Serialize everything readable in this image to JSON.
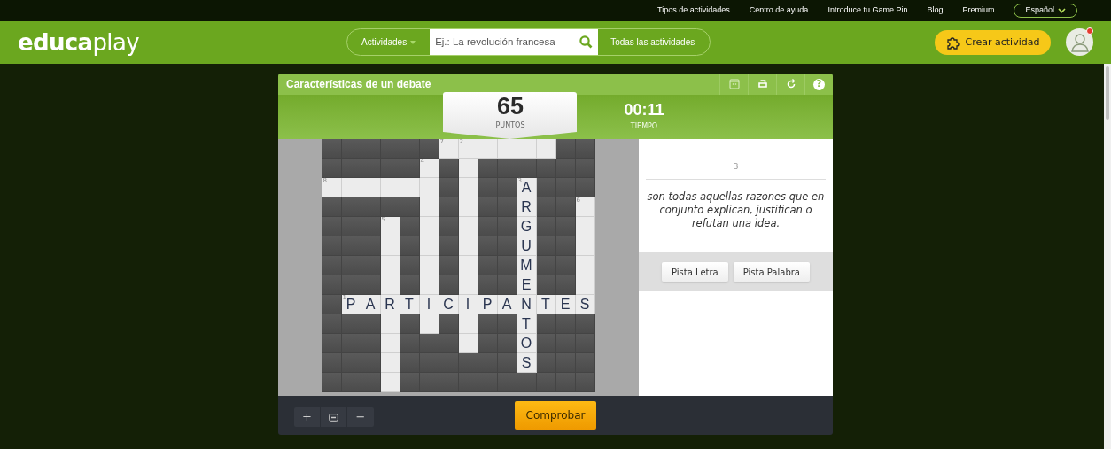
{
  "top_links": [
    "Tipos de actividades",
    "Centro de ayuda",
    "Introduce tu Game Pin",
    "Blog",
    "Premium"
  ],
  "language": {
    "label": "Español"
  },
  "logo": {
    "part1": "educa",
    "part2": "play"
  },
  "search": {
    "category": "Actividades",
    "placeholder": "Ej.: La revolución francesa",
    "all_label": "Todas las actividades"
  },
  "create_button": "Crear actividad",
  "user": {
    "notification": true
  },
  "activity": {
    "title": "Características de un debate",
    "score": {
      "value": "65",
      "label": "PUNTOS"
    },
    "timer": {
      "value": "00:11",
      "label": "TIEMPO"
    },
    "help_label": "?",
    "grid": [
      [
        {
          "kind": "block"
        },
        {
          "kind": "block"
        },
        {
          "kind": "block"
        },
        {
          "kind": "block"
        },
        {
          "kind": "block"
        },
        {
          "kind": "block"
        },
        {
          "kind": "open",
          "number": "7"
        },
        {
          "kind": "open",
          "number": "2"
        },
        {
          "kind": "open"
        },
        {
          "kind": "open"
        },
        {
          "kind": "open"
        },
        {
          "kind": "open"
        },
        {
          "kind": "block"
        },
        {
          "kind": "block"
        }
      ],
      [
        {
          "kind": "block"
        },
        {
          "kind": "block"
        },
        {
          "kind": "block"
        },
        {
          "kind": "block"
        },
        {
          "kind": "block"
        },
        {
          "kind": "open",
          "number": "4"
        },
        {
          "kind": "block"
        },
        {
          "kind": "open"
        },
        {
          "kind": "block"
        },
        {
          "kind": "block"
        },
        {
          "kind": "block"
        },
        {
          "kind": "block"
        },
        {
          "kind": "block"
        },
        {
          "kind": "block"
        }
      ],
      [
        {
          "kind": "open",
          "number": "8"
        },
        {
          "kind": "open"
        },
        {
          "kind": "open"
        },
        {
          "kind": "open"
        },
        {
          "kind": "open"
        },
        {
          "kind": "open"
        },
        {
          "kind": "block"
        },
        {
          "kind": "open"
        },
        {
          "kind": "block"
        },
        {
          "kind": "block"
        },
        {
          "kind": "open",
          "number": "3",
          "letter": "A"
        },
        {
          "kind": "block"
        },
        {
          "kind": "block"
        },
        {
          "kind": "block"
        }
      ],
      [
        {
          "kind": "block"
        },
        {
          "kind": "block"
        },
        {
          "kind": "block"
        },
        {
          "kind": "block"
        },
        {
          "kind": "block"
        },
        {
          "kind": "open"
        },
        {
          "kind": "block"
        },
        {
          "kind": "open"
        },
        {
          "kind": "block"
        },
        {
          "kind": "block"
        },
        {
          "kind": "open",
          "letter": "R"
        },
        {
          "kind": "block"
        },
        {
          "kind": "block"
        },
        {
          "kind": "open",
          "number": "6"
        }
      ],
      [
        {
          "kind": "block"
        },
        {
          "kind": "block"
        },
        {
          "kind": "block"
        },
        {
          "kind": "open",
          "number": "5"
        },
        {
          "kind": "block"
        },
        {
          "kind": "open"
        },
        {
          "kind": "block"
        },
        {
          "kind": "open"
        },
        {
          "kind": "block"
        },
        {
          "kind": "block"
        },
        {
          "kind": "open",
          "letter": "G"
        },
        {
          "kind": "block"
        },
        {
          "kind": "block"
        },
        {
          "kind": "open"
        }
      ],
      [
        {
          "kind": "block"
        },
        {
          "kind": "block"
        },
        {
          "kind": "block"
        },
        {
          "kind": "open"
        },
        {
          "kind": "block"
        },
        {
          "kind": "open"
        },
        {
          "kind": "block"
        },
        {
          "kind": "open"
        },
        {
          "kind": "block"
        },
        {
          "kind": "block"
        },
        {
          "kind": "open",
          "letter": "U"
        },
        {
          "kind": "block"
        },
        {
          "kind": "block"
        },
        {
          "kind": "open"
        }
      ],
      [
        {
          "kind": "block"
        },
        {
          "kind": "block"
        },
        {
          "kind": "block"
        },
        {
          "kind": "open"
        },
        {
          "kind": "block"
        },
        {
          "kind": "open"
        },
        {
          "kind": "block"
        },
        {
          "kind": "open"
        },
        {
          "kind": "block"
        },
        {
          "kind": "block"
        },
        {
          "kind": "open",
          "letter": "M"
        },
        {
          "kind": "block"
        },
        {
          "kind": "block"
        },
        {
          "kind": "open"
        }
      ],
      [
        {
          "kind": "block"
        },
        {
          "kind": "block"
        },
        {
          "kind": "block"
        },
        {
          "kind": "open"
        },
        {
          "kind": "block"
        },
        {
          "kind": "open"
        },
        {
          "kind": "block"
        },
        {
          "kind": "open"
        },
        {
          "kind": "block"
        },
        {
          "kind": "block"
        },
        {
          "kind": "open",
          "letter": "E"
        },
        {
          "kind": "block"
        },
        {
          "kind": "block"
        },
        {
          "kind": "open"
        }
      ],
      [
        {
          "kind": "block"
        },
        {
          "kind": "open",
          "number": "1",
          "letter": "P"
        },
        {
          "kind": "open",
          "letter": "A"
        },
        {
          "kind": "open",
          "letter": "R"
        },
        {
          "kind": "open",
          "letter": "T"
        },
        {
          "kind": "open",
          "letter": "I"
        },
        {
          "kind": "open",
          "letter": "C"
        },
        {
          "kind": "open",
          "letter": "I"
        },
        {
          "kind": "open",
          "letter": "P"
        },
        {
          "kind": "open",
          "letter": "A"
        },
        {
          "kind": "open",
          "letter": "N"
        },
        {
          "kind": "open",
          "letter": "T"
        },
        {
          "kind": "open",
          "letter": "E"
        },
        {
          "kind": "open",
          "letter": "S"
        }
      ],
      [
        {
          "kind": "block"
        },
        {
          "kind": "block"
        },
        {
          "kind": "block"
        },
        {
          "kind": "open"
        },
        {
          "kind": "block"
        },
        {
          "kind": "open"
        },
        {
          "kind": "block"
        },
        {
          "kind": "open"
        },
        {
          "kind": "block"
        },
        {
          "kind": "block"
        },
        {
          "kind": "open",
          "letter": "T"
        },
        {
          "kind": "block"
        },
        {
          "kind": "block"
        },
        {
          "kind": "block"
        }
      ],
      [
        {
          "kind": "block"
        },
        {
          "kind": "block"
        },
        {
          "kind": "block"
        },
        {
          "kind": "open"
        },
        {
          "kind": "block"
        },
        {
          "kind": "block"
        },
        {
          "kind": "block"
        },
        {
          "kind": "open"
        },
        {
          "kind": "block"
        },
        {
          "kind": "block"
        },
        {
          "kind": "open",
          "letter": "O"
        },
        {
          "kind": "block"
        },
        {
          "kind": "block"
        },
        {
          "kind": "block"
        }
      ],
      [
        {
          "kind": "block"
        },
        {
          "kind": "block"
        },
        {
          "kind": "block"
        },
        {
          "kind": "open"
        },
        {
          "kind": "block"
        },
        {
          "kind": "block"
        },
        {
          "kind": "block"
        },
        {
          "kind": "block"
        },
        {
          "kind": "block"
        },
        {
          "kind": "block"
        },
        {
          "kind": "open",
          "letter": "S"
        },
        {
          "kind": "block"
        },
        {
          "kind": "block"
        },
        {
          "kind": "block"
        }
      ],
      [
        {
          "kind": "block"
        },
        {
          "kind": "block"
        },
        {
          "kind": "block"
        },
        {
          "kind": "open"
        },
        {
          "kind": "block"
        },
        {
          "kind": "block"
        },
        {
          "kind": "block"
        },
        {
          "kind": "block"
        },
        {
          "kind": "block"
        },
        {
          "kind": "block"
        },
        {
          "kind": "block"
        },
        {
          "kind": "block"
        },
        {
          "kind": "block"
        },
        {
          "kind": "block"
        }
      ]
    ],
    "clue": {
      "number": "3",
      "text": "son todas aquellas razones que en conjunto explican, justifican o refutan una idea."
    },
    "hint_buttons": [
      "Pista Letra",
      "Pista Palabra"
    ],
    "zoom_buttons": [
      "+",
      "−"
    ],
    "check_button": "Comprobar"
  }
}
